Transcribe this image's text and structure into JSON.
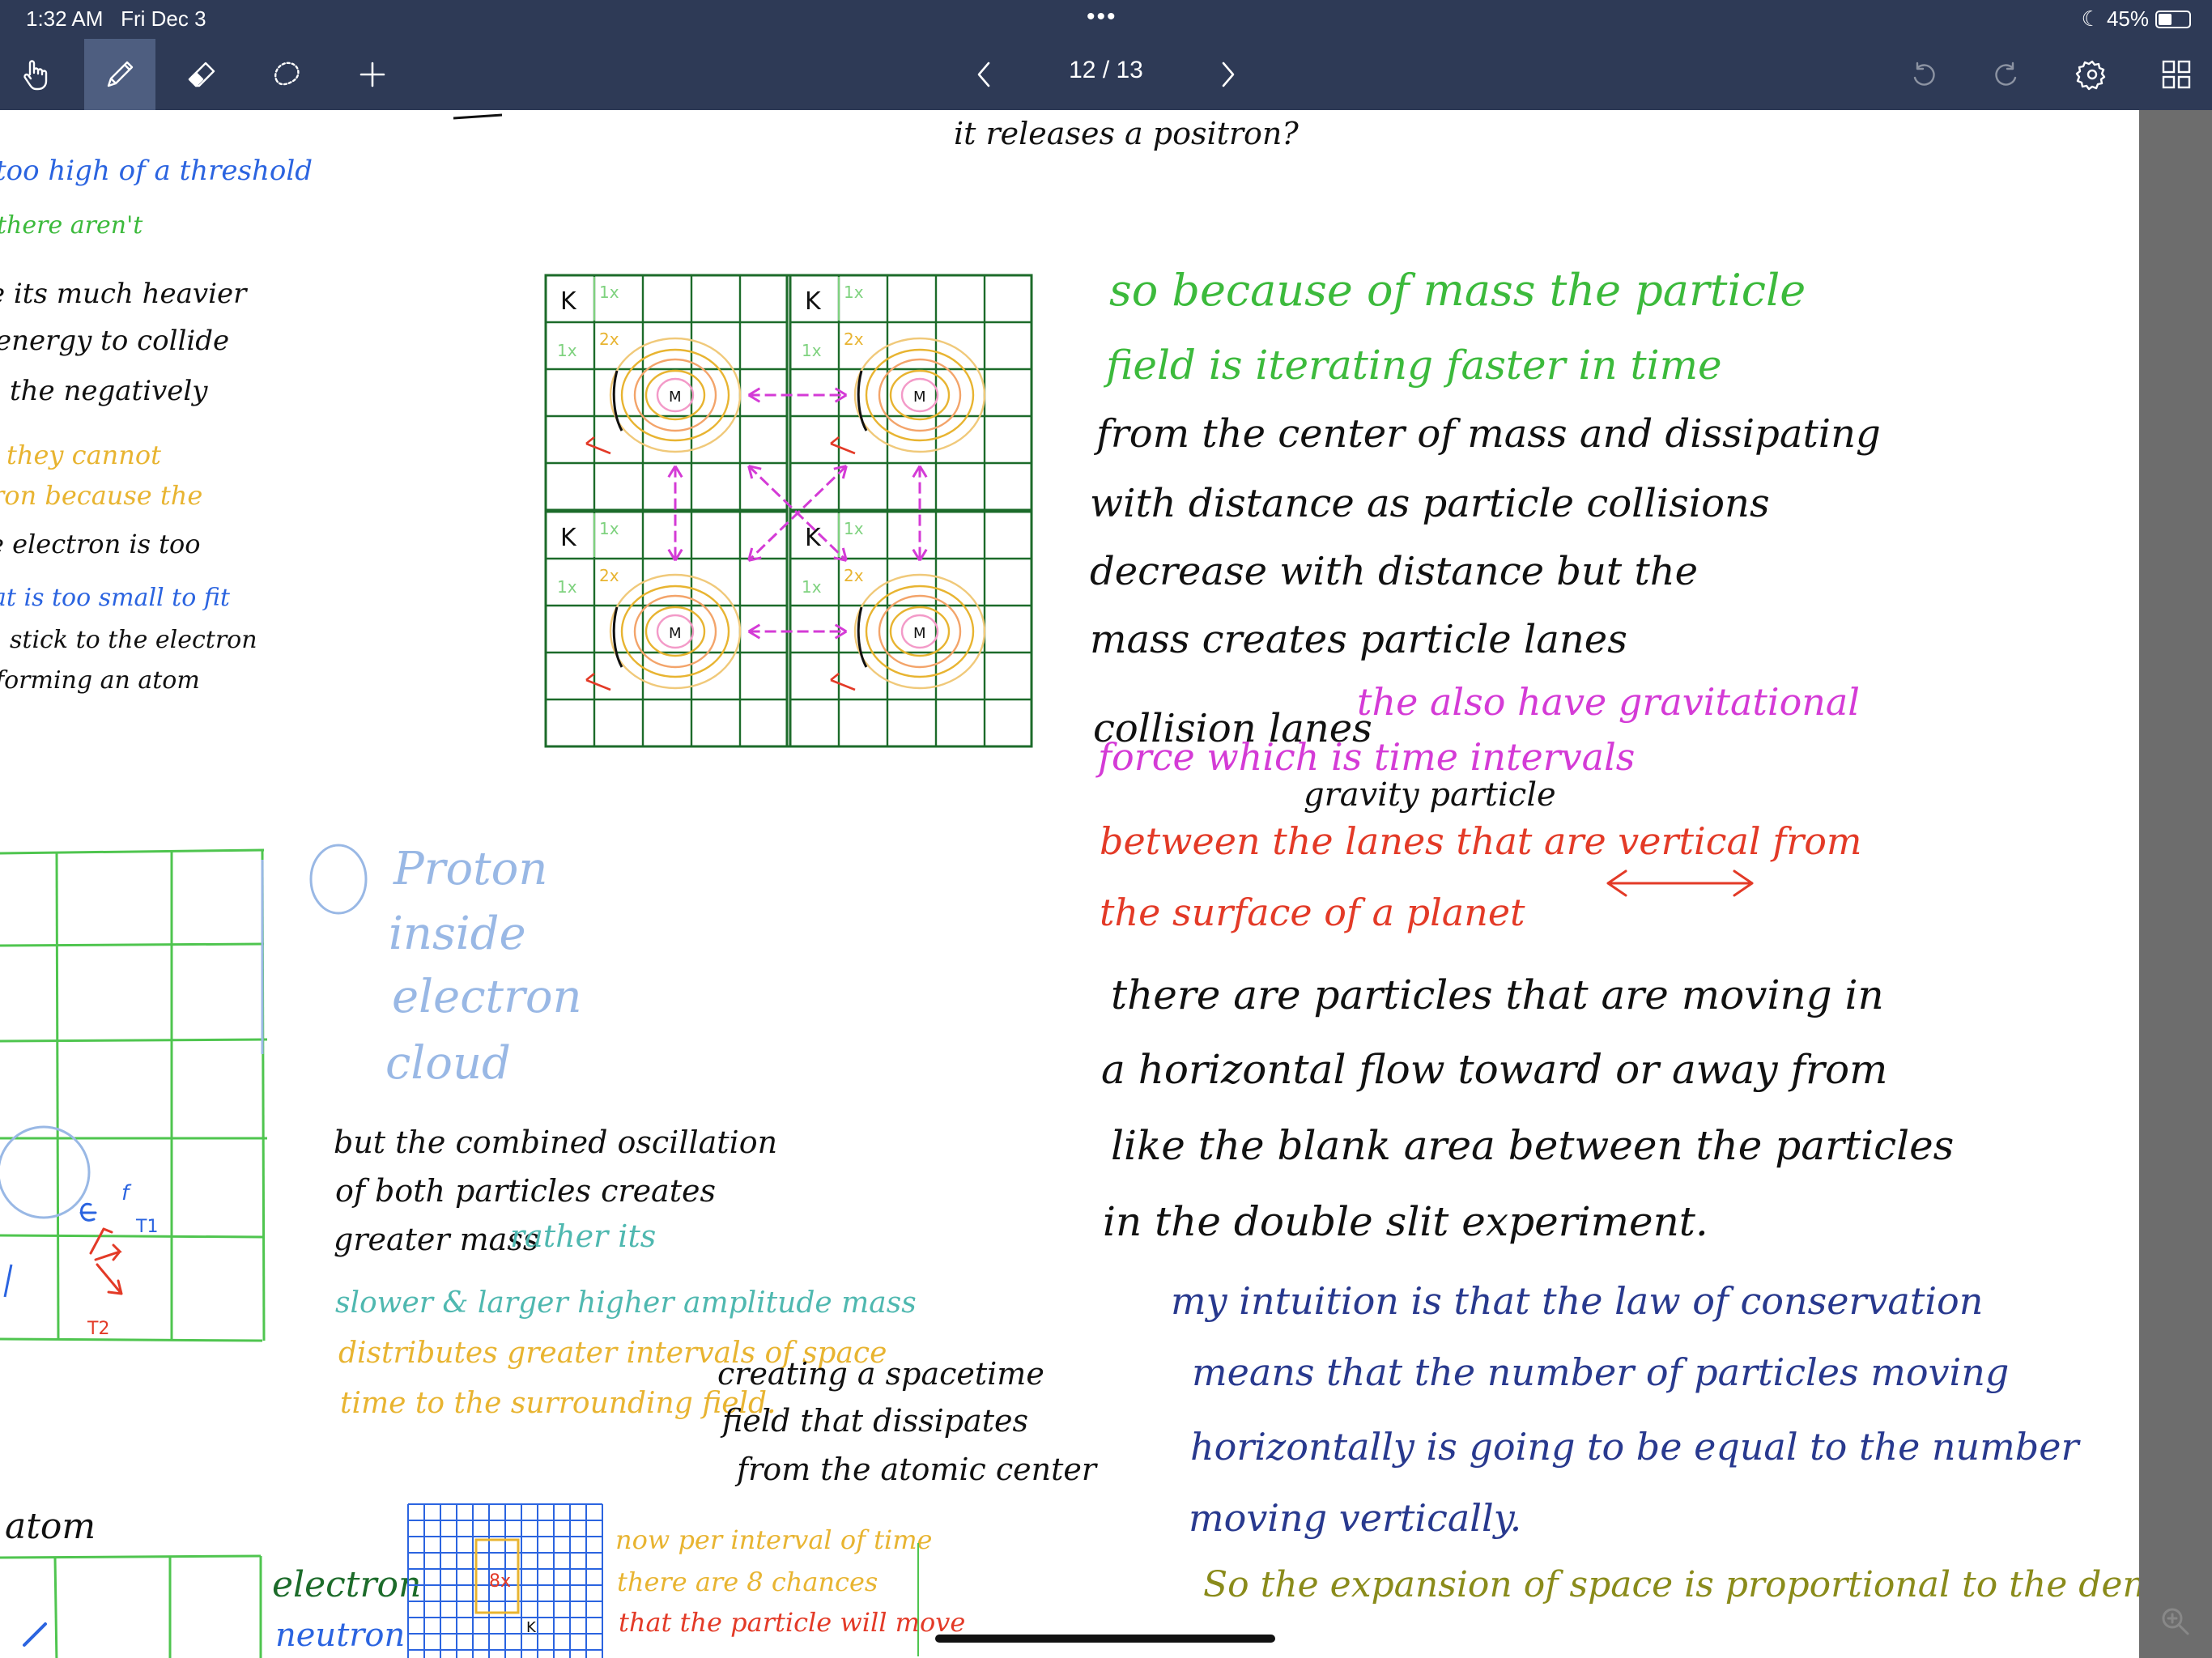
{
  "status_bar": {
    "time": "1:32 AM",
    "date": "Fri Dec 3",
    "dots": "•••",
    "battery_percent": "45%",
    "battery_level": 0.45
  },
  "toolbar": {
    "page_indicator": "12 / 13",
    "tools": [
      "hand-icon",
      "pen-icon",
      "eraser-icon",
      "lasso-icon",
      "plus-icon"
    ],
    "right_icons": [
      "undo-icon",
      "redo-icon",
      "gear-icon",
      "grid-icon"
    ],
    "accent": "#4e5e80",
    "background": "#2e3a56"
  },
  "notes": {
    "top_center": "it releases a positron?",
    "left_column": [
      "too high of a threshold",
      "there aren't",
      "e its much heavier",
      "energy to collide",
      "the negatively",
      "they cannot",
      "ron because the",
      "e electron is too",
      "at is too small to fit",
      "stick to the electron",
      "forming an atom"
    ],
    "right_column": [
      "so because of mass the particle",
      "field is iterating faster in time",
      "from the center of mass and dissipating",
      "with distance as particle collisions",
      "decrease with distance but the",
      "mass creates particle lanes",
      "collision lanes",
      "the also have gravitational",
      "force which is time intervals",
      "gravity particle",
      "between the lanes that are vertical from",
      "the surface of a planet"
    ],
    "horizontal_flow": [
      "there are particles that are moving in",
      "a horizontal flow toward or away from",
      "like the blank area between the particles",
      "in the double slit experiment."
    ],
    "intuition": [
      "my intuition is that the law of conservation",
      "means that the number of particles moving",
      "horizontally is going to be equal to the number",
      "moving vertically.",
      "So the expansion of space is proportional to the density"
    ],
    "proton_note": [
      "Proton",
      "inside",
      "electron",
      "cloud"
    ],
    "oscillation": [
      "but the combined oscillation",
      "of both particles creates",
      "greater mass",
      "rather its",
      "slower & larger higher amplitude mass",
      "distributes greater intervals of space",
      "time to the surrounding field.",
      "creating a spacetime",
      "field that dissipates",
      "from the atomic center"
    ],
    "bottom_left": [
      "atom",
      "electron",
      "neutron"
    ],
    "interval_note": [
      "now per interval of time",
      "there are 8 chances",
      "that the particle will move"
    ],
    "diagram_labels": {
      "k": "K",
      "m": "M",
      "one_x": "1x",
      "two_x": "2x",
      "eight_x": "8x",
      "e_label": "e",
      "t1": "T1",
      "t2": "T2"
    }
  }
}
